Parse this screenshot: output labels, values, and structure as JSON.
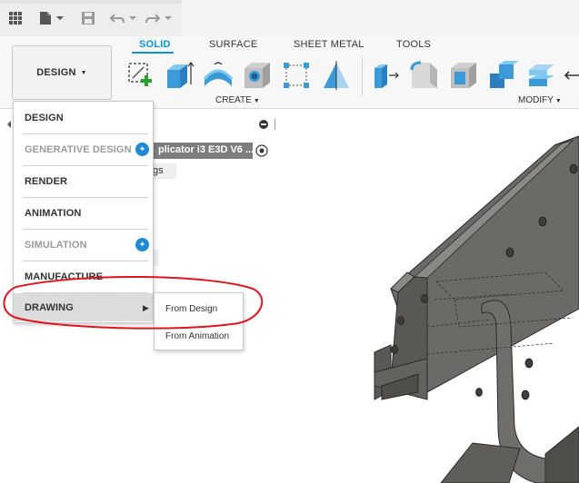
{
  "ribbon": {
    "workspace_button": "DESIGN",
    "tabs": [
      {
        "label": "SOLID",
        "active": true
      },
      {
        "label": "SURFACE",
        "active": false
      },
      {
        "label": "SHEET METAL",
        "active": false
      },
      {
        "label": "TOOLS",
        "active": false
      }
    ],
    "groups": {
      "create": "CREATE",
      "modify": "MODIFY"
    }
  },
  "browser": {
    "component_name": "plicator i3 E3D V6 ...",
    "settings_fragment": "gs"
  },
  "workspace_menu": {
    "items": [
      {
        "label": "DESIGN",
        "enabled": true
      },
      {
        "label": "GENERATIVE DESIGN",
        "enabled": false,
        "badge": true
      },
      {
        "label": "RENDER",
        "enabled": true
      },
      {
        "label": "ANIMATION",
        "enabled": true
      },
      {
        "label": "SIMULATION",
        "enabled": false,
        "badge": true
      },
      {
        "label": "MANUFACTURE",
        "enabled": true
      },
      {
        "label": "DRAWING",
        "enabled": true,
        "highlighted": true,
        "has_submenu": true
      }
    ],
    "drawing_submenu": [
      "From Design",
      "From Animation"
    ]
  },
  "annotation": {
    "color": "#e0141e",
    "shape": "red-ellipse-around-drawing-option"
  },
  "colors": {
    "accent": "#0696d7",
    "model_fill": "#6b6a66",
    "badge": "#1f8ad4"
  }
}
